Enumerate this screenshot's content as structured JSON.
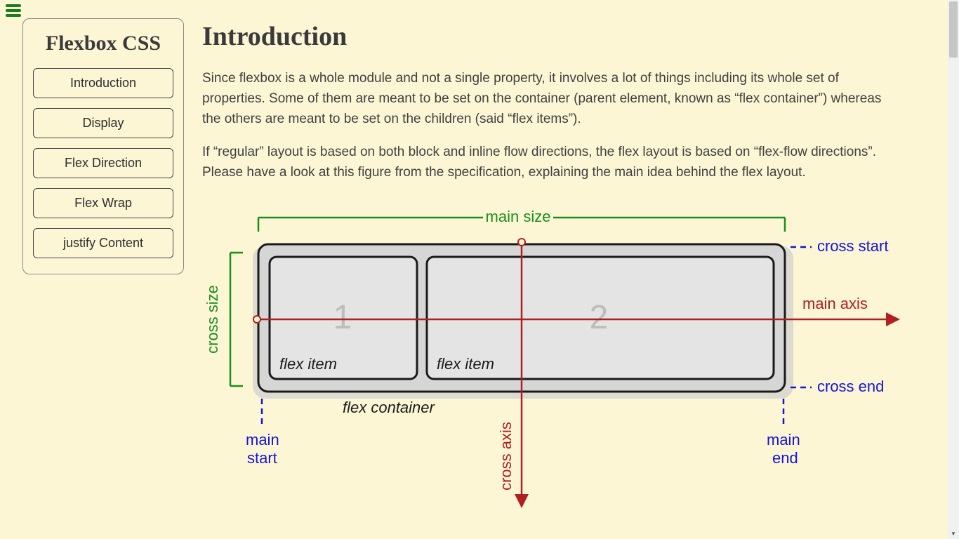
{
  "sidebar": {
    "title": "Flexbox CSS",
    "items": [
      {
        "label": "Introduction"
      },
      {
        "label": "Display"
      },
      {
        "label": "Flex Direction"
      },
      {
        "label": "Flex Wrap"
      },
      {
        "label": "justify Content"
      }
    ]
  },
  "page": {
    "heading": "Introduction",
    "para1": "Since flexbox is a whole module and not a single property, it involves a lot of things including its whole set of properties. Some of them are meant to be set on the container (parent element, known as “flex container”) whereas the others are meant to be set on the children (said “flex items”).",
    "para2": "If “regular” layout is based on both block and inline flow directions, the flex layout is based on “flex-flow directions”. Please have a look at this figure from the specification, explaining the main idea behind the flex layout."
  },
  "diagram": {
    "main_size": "main size",
    "cross_size": "cross size",
    "main_axis": "main axis",
    "cross_axis": "cross axis",
    "cross_start": "cross start",
    "cross_end": "cross end",
    "main_start": "main\nstart",
    "main_end": "main\nend",
    "flex_container": "flex container",
    "flex_item": "flex item",
    "item1_num": "1",
    "item2_num": "2",
    "colors": {
      "green": "#1a8e1a",
      "blue": "#1414d6",
      "red": "#b02020",
      "grey_text": "#b8b8b8",
      "box_fill": "#e2e2e2",
      "box_stroke": "#1a1a1a",
      "container_fill": "#d2d2d2"
    }
  }
}
